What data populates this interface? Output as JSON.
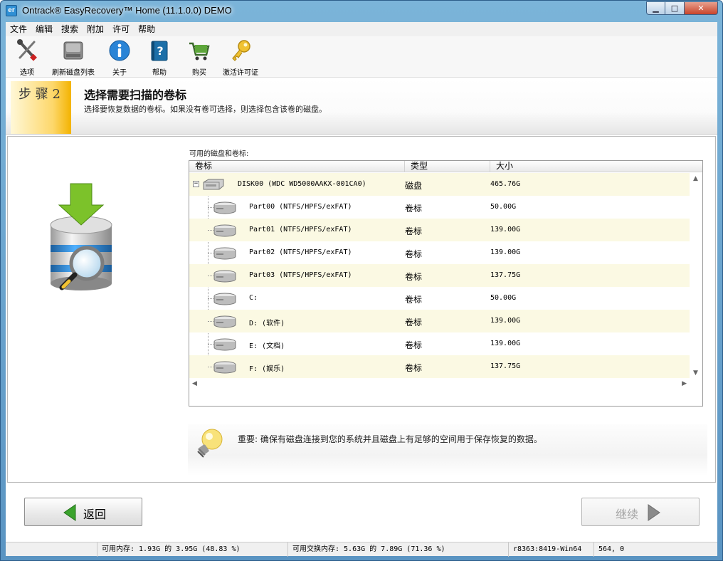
{
  "window": {
    "title": "Ontrack® EasyRecovery™ Home (11.1.0.0) DEMO",
    "app_icon_text": "er",
    "buttons": {
      "minimize": "▁",
      "maximize": "□",
      "close": "✕"
    }
  },
  "menu": [
    "文件",
    "编辑",
    "搜索",
    "附加",
    "许可",
    "帮助"
  ],
  "toolbar": [
    {
      "label": "选项",
      "icon": "tools-icon"
    },
    {
      "label": "刷新磁盘列表",
      "icon": "refresh-disk-icon"
    },
    {
      "label": "关于",
      "icon": "info-icon"
    },
    {
      "label": "帮助",
      "icon": "help-book-icon"
    },
    {
      "label": "购买",
      "icon": "shopping-cart-icon"
    },
    {
      "label": "激活许可证",
      "icon": "key-icon"
    }
  ],
  "step": {
    "label": "步 骤  2",
    "title": "选择需要扫描的卷标",
    "description": "选择要恢复数据的卷标。如果没有卷可选择，则选择包含该卷的磁盘。"
  },
  "volumes": {
    "caption": "可用的磁盘和卷标:",
    "columns": [
      "卷标",
      "类型",
      "大小"
    ],
    "rows": [
      {
        "name": "DISK00 (WDC WD5000AAKX-001CA0)",
        "type": "磁盘",
        "size": "465.76G",
        "level": 0
      },
      {
        "name": "Part00 (NTFS/HPFS/exFAT)",
        "type": "卷标",
        "size": "50.00G",
        "level": 1
      },
      {
        "name": "Part01 (NTFS/HPFS/exFAT)",
        "type": "卷标",
        "size": "139.00G",
        "level": 1
      },
      {
        "name": "Part02 (NTFS/HPFS/exFAT)",
        "type": "卷标",
        "size": "139.00G",
        "level": 1
      },
      {
        "name": "Part03 (NTFS/HPFS/exFAT)",
        "type": "卷标",
        "size": "137.75G",
        "level": 1
      },
      {
        "name": "C:",
        "type": "卷标",
        "size": "50.00G",
        "level": 1
      },
      {
        "name": "D: (软件)",
        "type": "卷标",
        "size": "139.00G",
        "level": 1
      },
      {
        "name": "E: (文档)",
        "type": "卷标",
        "size": "139.00G",
        "level": 1
      },
      {
        "name": "F: (娱乐)",
        "type": "卷标",
        "size": "137.75G",
        "level": 1
      }
    ]
  },
  "notice": {
    "text": "重要: 确保有磁盘连接到您的系统并且磁盘上有足够的空间用于保存恢复的数据。"
  },
  "nav": {
    "back": "返回",
    "next": "继续"
  },
  "status": {
    "memory": "可用内存: 1.93G 的 3.95G (48.83 %)",
    "swap": "可用交换内存: 5.63G 的 7.89G (71.36 %)",
    "build": "r8363:8419-Win64",
    "coords": "564, 0"
  },
  "colors": {
    "alt_row": "#fbf9e3",
    "step_accent": "#f3b300",
    "title_bar": "#6aa5d0"
  }
}
